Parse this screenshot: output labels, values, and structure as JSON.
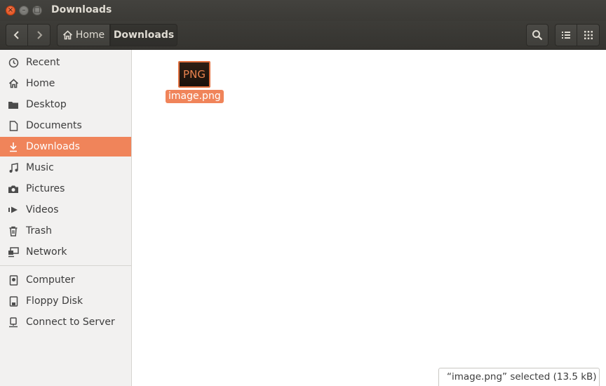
{
  "window": {
    "title": "Downloads",
    "close_glyph": "×",
    "min_glyph": "–",
    "max_glyph": "□"
  },
  "toolbar": {
    "back_icon": "chevron-left-icon",
    "forward_icon": "chevron-right-icon",
    "breadcrumb_home": "Home",
    "breadcrumb_current": "Downloads",
    "search_icon": "search-icon",
    "list_view_icon": "list-view-icon",
    "grid_view_icon": "grid-view-icon"
  },
  "sidebar": {
    "places": [
      {
        "label": "Recent",
        "icon": "clock-icon"
      },
      {
        "label": "Home",
        "icon": "home-icon"
      },
      {
        "label": "Desktop",
        "icon": "folder-icon"
      },
      {
        "label": "Documents",
        "icon": "document-icon"
      },
      {
        "label": "Downloads",
        "icon": "download-icon",
        "active": true
      },
      {
        "label": "Music",
        "icon": "music-icon"
      },
      {
        "label": "Pictures",
        "icon": "camera-icon"
      },
      {
        "label": "Videos",
        "icon": "video-icon"
      },
      {
        "label": "Trash",
        "icon": "trash-icon"
      },
      {
        "label": "Network",
        "icon": "network-icon"
      }
    ],
    "devices": [
      {
        "label": "Computer",
        "icon": "drive-icon"
      },
      {
        "label": "Floppy Disk",
        "icon": "floppy-icon"
      },
      {
        "label": "Connect to Server",
        "icon": "server-icon"
      }
    ]
  },
  "files": [
    {
      "name": "image.png",
      "thumb_text": "PNG",
      "selected": true
    }
  ],
  "status": {
    "text": "“image.png” selected  (13.5 kB)"
  },
  "colors": {
    "accent": "#f0845a",
    "titlebar": "#3c3b37",
    "sidebar_bg": "#f2f1f0"
  }
}
